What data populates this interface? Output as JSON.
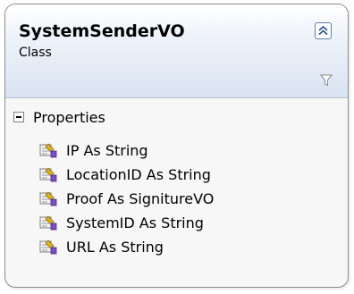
{
  "class_shape": {
    "name": "SystemSenderVO",
    "kind": "Class",
    "collapse_icon": "double-chevron-up-icon",
    "filter_icon": "funnel-icon"
  },
  "properties_section": {
    "label": "Properties",
    "toggle_icon": "minus-box-icon",
    "member_icon": "property-icon",
    "members": [
      {
        "label": "IP As String"
      },
      {
        "label": "LocationID As String"
      },
      {
        "label": "Proof As SignitureVO"
      },
      {
        "label": "SystemID As String"
      },
      {
        "label": "URL As String"
      }
    ]
  },
  "colors": {
    "border": "#8c8c8c",
    "header_gradient_end": "#d9e3f1",
    "body": "#f7f7f7"
  }
}
